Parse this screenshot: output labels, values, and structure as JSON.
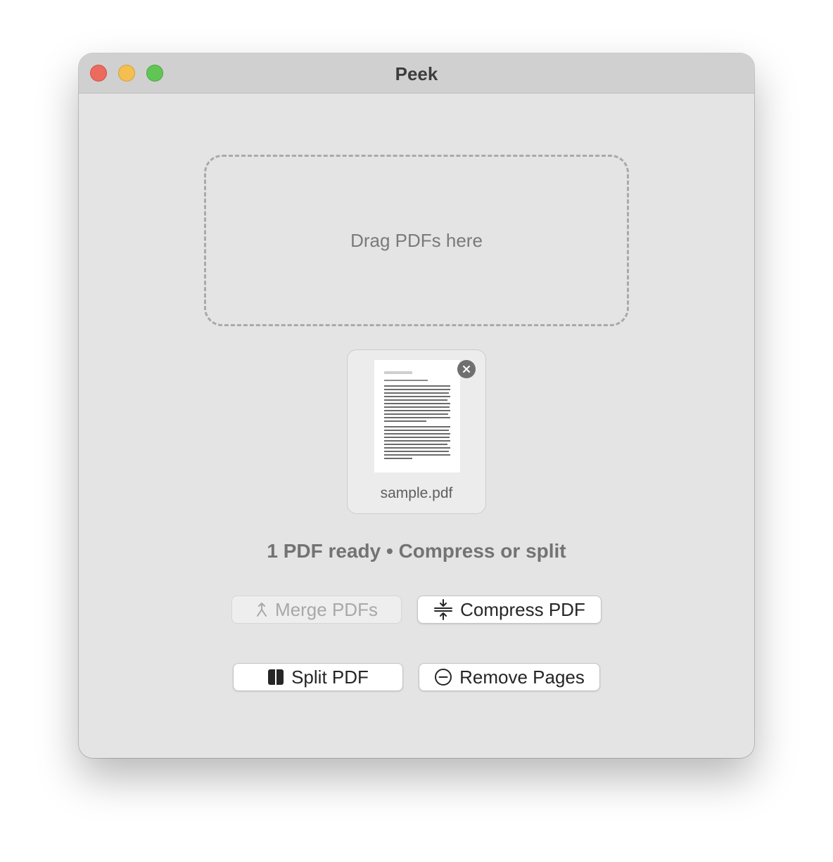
{
  "window": {
    "title": "Peek"
  },
  "dropzone": {
    "label": "Drag PDFs here"
  },
  "files": [
    {
      "name": "sample.pdf"
    }
  ],
  "status": {
    "text": "1 PDF ready • Compress or split"
  },
  "actions": {
    "merge": {
      "label": "Merge PDFs",
      "enabled": false,
      "icon": "merge-icon"
    },
    "compress": {
      "label": "Compress PDF",
      "enabled": true,
      "icon": "compress-icon"
    },
    "split": {
      "label": "Split PDF",
      "enabled": true,
      "icon": "split-icon"
    },
    "remove_pages": {
      "label": "Remove Pages",
      "enabled": true,
      "icon": "minus-circle-icon"
    }
  },
  "colors": {
    "close": "#ec6a5e",
    "minimize": "#f4bf4f",
    "maximize": "#61c554"
  }
}
